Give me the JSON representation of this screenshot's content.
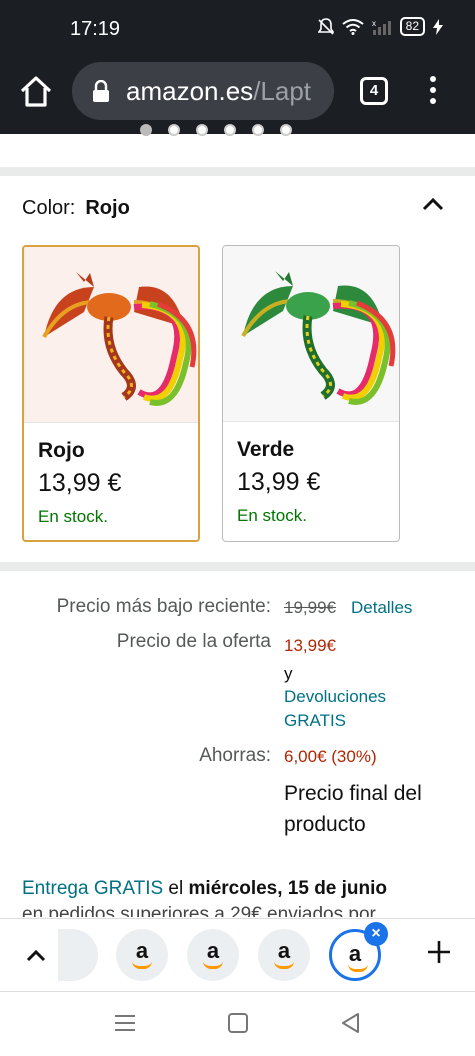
{
  "status_bar": {
    "time": "17:19",
    "battery": "82"
  },
  "browser": {
    "url_host": "amazon.es",
    "url_rest": "/Lapt",
    "tab_count": "4"
  },
  "color_section": {
    "label": "Color:",
    "selected": "Rojo",
    "options": [
      {
        "name": "Rojo",
        "price": "13,99 €",
        "stock": "En stock."
      },
      {
        "name": "Verde",
        "price": "13,99 €",
        "stock": "En stock."
      }
    ]
  },
  "pricing": {
    "recent_low_label": "Precio más bajo reciente:",
    "recent_low_value": "19,99€",
    "details_link": "Detalles",
    "offer_label": "Precio de la oferta",
    "offer_value": "13,99€",
    "and": "y",
    "returns_line1": "Devoluciones",
    "returns_line2": "GRATIS",
    "savings_label": "Ahorras:",
    "savings_value": "6,00€ (30%)",
    "final_line1": "Precio final del",
    "final_line2": "producto"
  },
  "delivery": {
    "free_link": "Entrega GRATIS",
    "middle": " el ",
    "date": "miércoles, 15 de junio",
    "cut_text": "en pedidos superiores a 29€ enviados por"
  },
  "tab_strip": {
    "tab_letter": "a"
  },
  "colors": {
    "accent_teal": "#007185",
    "price_red": "#b12704",
    "stock_green": "#007600",
    "selected_border": "#d9a240",
    "chrome_dark": "#1b1f24"
  }
}
